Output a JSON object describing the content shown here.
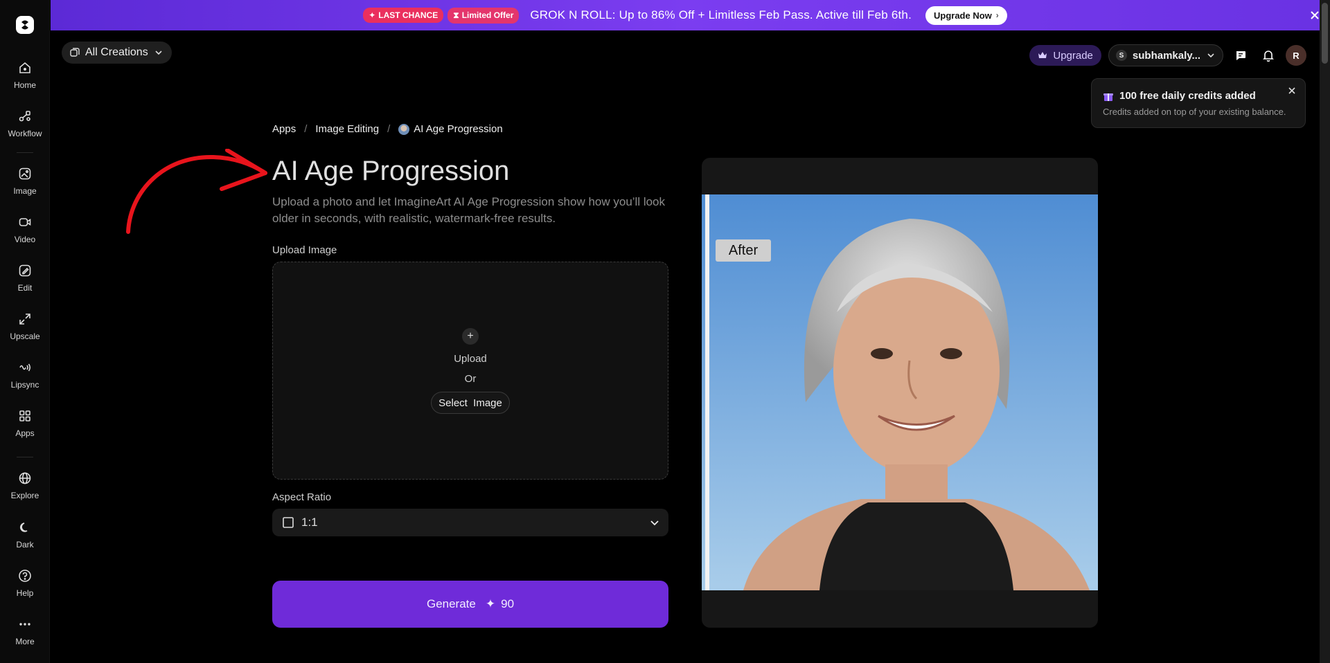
{
  "sidebar": {
    "items": [
      {
        "label": "Home",
        "icon": "home-icon"
      },
      {
        "label": "Workflow",
        "icon": "workflow-icon"
      },
      {
        "label": "Image",
        "icon": "image-icon"
      },
      {
        "label": "Video",
        "icon": "video-icon"
      },
      {
        "label": "Edit",
        "icon": "edit-icon"
      },
      {
        "label": "Upscale",
        "icon": "upscale-icon"
      },
      {
        "label": "Lipsync",
        "icon": "lipsync-icon"
      },
      {
        "label": "Apps",
        "icon": "apps-icon"
      },
      {
        "label": "Explore",
        "icon": "globe-icon"
      },
      {
        "label": "Dark",
        "icon": "moon-icon"
      },
      {
        "label": "Help",
        "icon": "help-icon"
      },
      {
        "label": "More",
        "icon": "more-icon"
      }
    ]
  },
  "banner": {
    "badge1": "LAST CHANCE",
    "badge2": "Limited Offer",
    "text": "GROK N ROLL: Up to 86% Off + Limitless Feb Pass. Active till Feb 6th.",
    "cta": "Upgrade Now"
  },
  "header": {
    "all_creations": "All Creations",
    "upgrade": "Upgrade",
    "account_initial": "S",
    "account_name": "subhamkaly...",
    "avatar_initial": "R"
  },
  "toast": {
    "title": "100 free daily credits added",
    "subtitle": "Credits added on top of your existing balance."
  },
  "breadcrumb": {
    "apps": "Apps",
    "category": "Image Editing",
    "current": "AI Age Progression"
  },
  "main": {
    "title": "AI Age Progression",
    "subtitle": "Upload a photo and let ImagineArt AI Age Progression show how you’ll look older in seconds, with realistic, watermark-free results.",
    "upload_label": "Upload Image",
    "upload_text": "Upload",
    "or_text": "Or",
    "select_image": "Select  Image",
    "aspect_label": "Aspect Ratio",
    "aspect_value": "1:1",
    "generate_label": "Generate",
    "generate_cost": "90"
  },
  "preview": {
    "tag": "After"
  },
  "colors": {
    "accent": "#6f2bd9",
    "banner": "#7b3df0",
    "arrow": "#e8141c"
  }
}
